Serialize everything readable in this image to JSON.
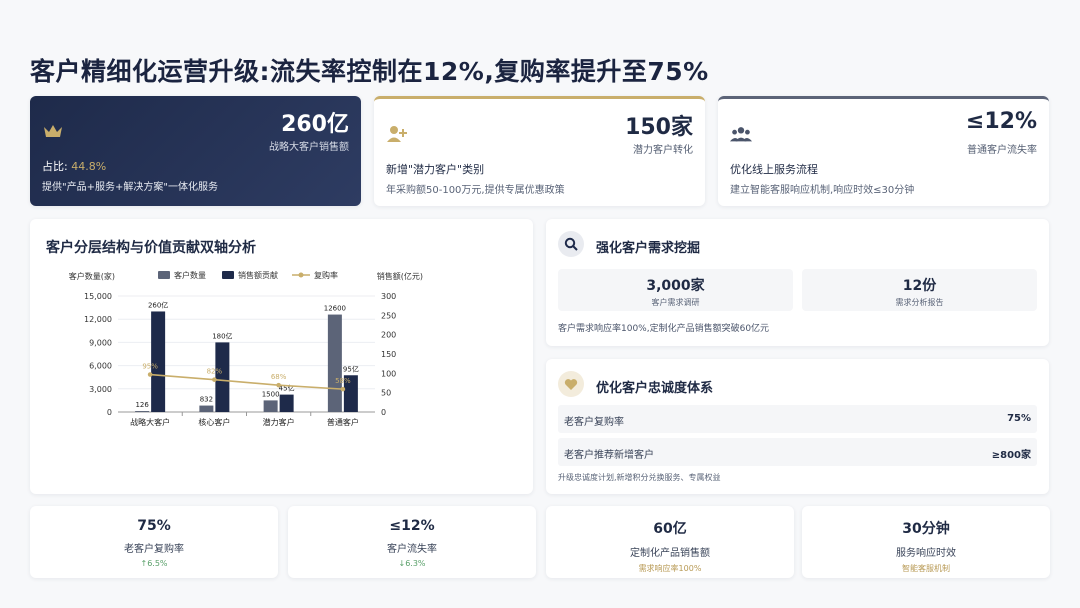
{
  "title": "客户精细化运营升级:流失率控制在12%,复购率提升至75%",
  "top_cards": [
    {
      "value": "260亿",
      "sub": "战略大客户销售额",
      "line1_prefix": "占比: ",
      "line1_value": "44.8%",
      "line2": "提供\"产品+服务+解决方案\"一体化服务",
      "icon": "crown-icon"
    },
    {
      "value": "150家",
      "sub": "潜力客户转化",
      "line1": "新增\"潜力客户\"类别",
      "line2": "年采购额50-100万元,提供专属优惠政策",
      "icon": "add-user-icon"
    },
    {
      "value": "≤12%",
      "sub": "普通客户流失率",
      "line1": "优化线上服务流程",
      "line2": "建立智能客服响应机制,响应时效≤30分钟",
      "icon": "group-icon"
    }
  ],
  "chart_title": "客户分层结构与价值贡献双轴分析",
  "chart_data": {
    "type": "bar",
    "categories": [
      "战略大客户",
      "核心客户",
      "潜力客户",
      "普通客户"
    ],
    "series": [
      {
        "name": "客户数量",
        "axis": "left",
        "values": [
          126,
          832,
          1500,
          12600
        ],
        "labels": [
          "126",
          "832",
          "1500",
          "12600"
        ],
        "color": "#5c6478"
      },
      {
        "name": "销售额贡献",
        "axis": "right",
        "values": [
          260,
          180,
          45,
          95
        ],
        "labels": [
          "260亿",
          "180亿",
          "45亿",
          "95亿"
        ],
        "color": "#1e2a4a"
      },
      {
        "name": "复购率",
        "type": "line",
        "values": [
          95,
          82,
          68,
          58
        ],
        "labels": [
          "95%",
          "82%",
          "68%",
          "58%"
        ],
        "color": "#c9ae6b"
      }
    ],
    "ylabel": "客户数量(家)",
    "y2label": "销售额(亿元)",
    "ylim": [
      0,
      15000
    ],
    "y2lim": [
      0,
      300
    ],
    "yticks": [
      "0",
      "3,000",
      "6,000",
      "9,000",
      "12,000",
      "15,000"
    ],
    "y2ticks": [
      "0",
      "50",
      "100",
      "150",
      "200",
      "250",
      "300"
    ],
    "legend": "top",
    "grid": true
  },
  "demand": {
    "title": "强化客户需求挖掘",
    "icon": "search-icon",
    "stats": [
      {
        "value": "3,000家",
        "label": "客户需求调研"
      },
      {
        "value": "12份",
        "label": "需求分析报告"
      }
    ],
    "note": "客户需求响应率100%,定制化产品销售额突破60亿元"
  },
  "loyalty": {
    "title": "优化客户忠诚度体系",
    "icon": "heart-icon",
    "rows": [
      {
        "label": "老客户复购率",
        "value": "75%"
      },
      {
        "label": "老客户推荐新增客户",
        "value": "≥800家"
      }
    ],
    "note": "升级忠诚度计划,新增积分兑换服务、专属权益"
  },
  "bottom": [
    {
      "value": "75%",
      "label": "老客户复购率",
      "sub": "↑6.5%",
      "tone": "green"
    },
    {
      "value": "≤12%",
      "label": "客户流失率",
      "sub": "↓6.3%",
      "tone": "green"
    },
    {
      "value": "60亿",
      "label": "定制化产品销售额",
      "sub": "需求响应率100%",
      "tone": "gold"
    },
    {
      "value": "30分钟",
      "label": "服务响应时效",
      "sub": "智能客服机制",
      "tone": "gold"
    }
  ]
}
